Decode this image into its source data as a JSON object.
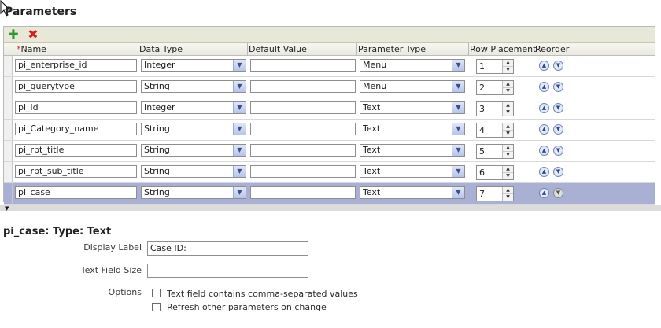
{
  "page": {
    "title": "Parameters"
  },
  "toolbar": {
    "add_icon": "plus-icon",
    "delete_icon": "x-icon"
  },
  "columns": {
    "name": "Name",
    "required_marker": "*",
    "data_type": "Data Type",
    "default_value": "Default Value",
    "parameter_type": "Parameter Type",
    "row_placement": "Row Placement",
    "reorder": "Reorder"
  },
  "rows": [
    {
      "name": "pi_enterprise_id",
      "data_type": "Integer",
      "default_value": "",
      "parameter_type": "Menu",
      "row_placement": "1"
    },
    {
      "name": "pi_querytype",
      "data_type": "String",
      "default_value": "",
      "parameter_type": "Menu",
      "row_placement": "2"
    },
    {
      "name": "pi_id",
      "data_type": "Integer",
      "default_value": "",
      "parameter_type": "Text",
      "row_placement": "3"
    },
    {
      "name": "pi_Category_name",
      "data_type": "String",
      "default_value": "",
      "parameter_type": "Text",
      "row_placement": "4"
    },
    {
      "name": "pi_rpt_title",
      "data_type": "String",
      "default_value": "",
      "parameter_type": "Text",
      "row_placement": "5"
    },
    {
      "name": "pi_rpt_sub_title",
      "data_type": "String",
      "default_value": "",
      "parameter_type": "Text",
      "row_placement": "6"
    },
    {
      "name": "pi_case",
      "data_type": "String",
      "default_value": "",
      "parameter_type": "Text",
      "row_placement": "7",
      "selected": true
    }
  ],
  "details": {
    "heading": "pi_case: Type: Text",
    "display_label_label": "Display Label",
    "display_label_value": "Case ID:",
    "text_field_size_label": "Text Field Size",
    "text_field_size_value": "",
    "options_label": "Options",
    "option_comma_separated": "Text field contains comma-separated values",
    "option_comma_separated_checked": false,
    "option_refresh": "Refresh other parameters on change",
    "option_refresh_checked": false
  },
  "colors": {
    "selected_row": "#a9b0d3",
    "toolbar": "#e8e8d8",
    "add": "#2e9a2e",
    "delete": "#d42020"
  }
}
